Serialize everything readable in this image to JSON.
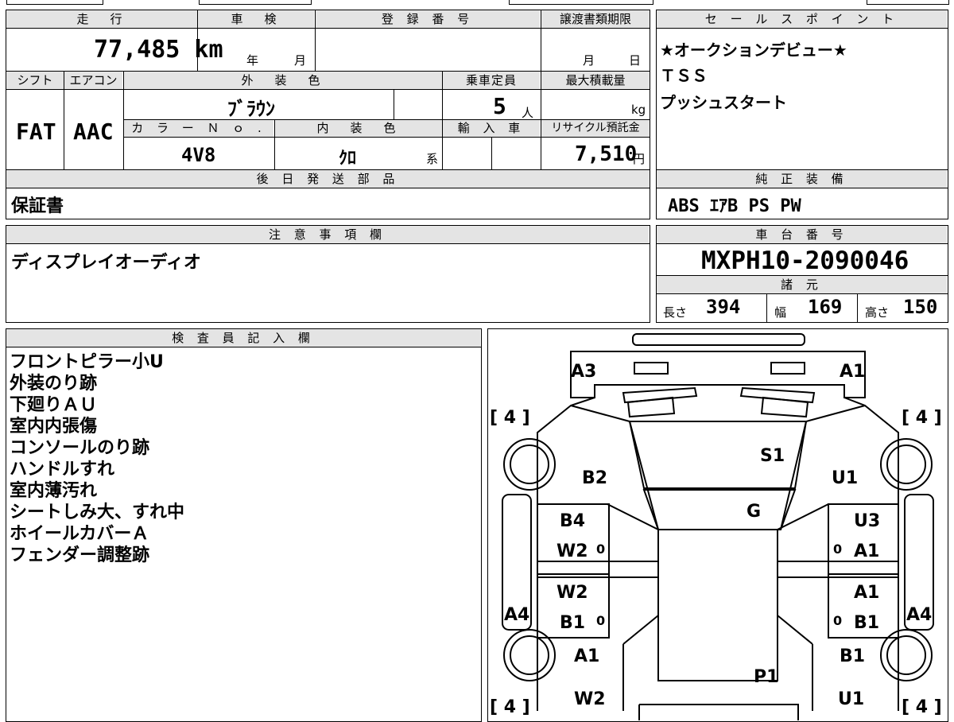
{
  "mileage": {
    "label": "走　行",
    "value": "77,485 km"
  },
  "shaken": {
    "label": "車　検",
    "year": "年",
    "month": "月"
  },
  "registration": {
    "label": "登 録 番 号",
    "value": ""
  },
  "transfer_deadline": {
    "label": "譲渡書類期限",
    "month": "月",
    "day": "日"
  },
  "sales_points": {
    "label": "セ ー ル ス ポ イ ン ト",
    "lines": [
      "★オークションデビュー★",
      "ＴＳＳ",
      "プッシュスタート"
    ]
  },
  "shift": {
    "label": "シフト",
    "value": "FAT"
  },
  "aircon": {
    "label": "エアコン",
    "value": "AAC"
  },
  "exterior_color": {
    "label": "外　装　色",
    "value": "ﾌﾞﾗｳﾝ"
  },
  "capacity": {
    "label": "乗車定員",
    "value": "5",
    "unit": "人"
  },
  "max_load": {
    "label": "最大積載量",
    "unit": "kg"
  },
  "color_no": {
    "label": "カ ラ ー Ｎ ｏ .",
    "value": "4V8"
  },
  "interior_color": {
    "label": "内　装　色",
    "value": "ｸﾛ",
    "suffix": "系"
  },
  "import": {
    "label": "輸 入 車"
  },
  "recycle": {
    "label": "リサイクル預託金",
    "value": "7,510",
    "unit": "円"
  },
  "later_parts": {
    "label": "後 日 発 送 部 品",
    "value": "保証書"
  },
  "equipment": {
    "label": "純 正 装 備",
    "value": "ABS ｴｱB PS PW"
  },
  "notes": {
    "label": "注 意 事 項 欄",
    "value": "ディスプレイオーディオ"
  },
  "chassis": {
    "label": "車 台 番 号",
    "value": "MXPH10-2090046"
  },
  "specs": {
    "label": "諸 元",
    "length_label": "長さ",
    "length": "394",
    "width_label": "幅",
    "width": "169",
    "height_label": "高さ",
    "height": "150"
  },
  "inspector": {
    "label": "検 査 員 記 入 欄",
    "lines": [
      "フロントピラー小U",
      "外装のり跡",
      "下廻りＡＵ",
      "室内内張傷",
      "コンソールのり跡",
      "ハンドルすれ",
      "室内薄汚れ",
      "シートしみ大、すれ中",
      "ホイールカバーＡ",
      "フェンダー調整跡"
    ]
  },
  "diagram": {
    "marks": {
      "a3": "A3",
      "a1_front": "A1",
      "s1": "S1",
      "b2_left": "B2",
      "u1_right": "U1",
      "g": "G",
      "b4": "B4",
      "u3": "U3",
      "w2_fl": "W2",
      "a1_fr": "A1",
      "w2_rl": "W2",
      "a1_rr": "A1",
      "b1_rl": "B1",
      "b1_rr": "B1",
      "a4_left": "A4",
      "a4_right": "A4",
      "a1_rear_left": "A1",
      "b1_rear_right": "B1",
      "p1": "P1",
      "w2_rear": "W2",
      "u1_rear": "U1"
    },
    "zeros": [
      "0",
      "0",
      "0",
      "0"
    ],
    "tire_left_top": "[ 4 ]",
    "tire_right_top": "[ 4 ]",
    "tire_left_bottom": "[ 4 ]",
    "tire_right_bottom": "[ 4 ]"
  }
}
